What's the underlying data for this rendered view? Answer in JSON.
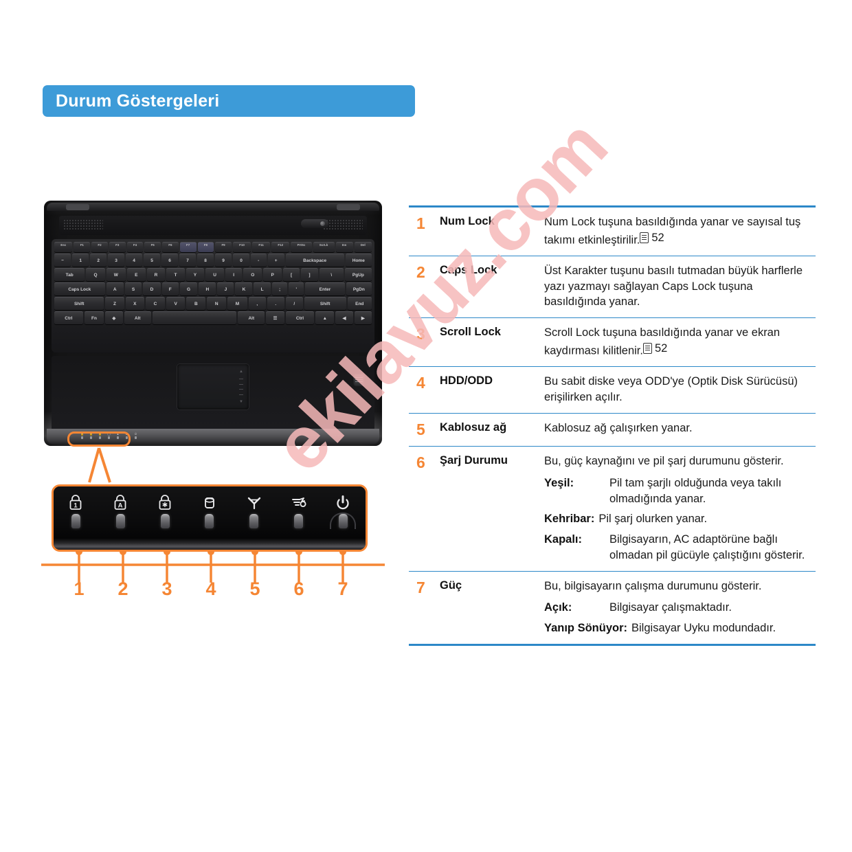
{
  "header": {
    "title": "Durum Göstergeleri",
    "bg_color": "#3d9bd8"
  },
  "watermark": {
    "text": "ekilavuz.com",
    "color": "#f6b9b9"
  },
  "colors": {
    "accent_orange": "#f58634",
    "table_blue": "#2c88c8",
    "header_blue": "#3d9bd8"
  },
  "figure": {
    "callout_numbers": [
      "1",
      "2",
      "3",
      "4",
      "5",
      "6",
      "7"
    ],
    "indicators": [
      {
        "number": "1",
        "icon": "num-lock-icon",
        "glyph": "1"
      },
      {
        "number": "2",
        "icon": "caps-lock-icon",
        "glyph": "A"
      },
      {
        "number": "3",
        "icon": "scroll-lock-icon",
        "glyph": "*"
      },
      {
        "number": "4",
        "icon": "hdd-odd-icon",
        "glyph": ""
      },
      {
        "number": "5",
        "icon": "wireless-network-icon",
        "glyph": ""
      },
      {
        "number": "6",
        "icon": "charge-status-icon",
        "glyph": ""
      },
      {
        "number": "7",
        "icon": "power-icon",
        "glyph": ""
      }
    ]
  },
  "table": {
    "rows": [
      {
        "number": "1",
        "label": "Num Lock",
        "desc_before": "Num Lock tuşuna basıldığında yanar ve sayısal tuş takımı etkinleştirilir.",
        "page_ref": "52",
        "subs": []
      },
      {
        "number": "2",
        "label": "Caps Lock",
        "desc_before": "Üst Karakter tuşunu basılı tutmadan büyük harflerle yazı yazmayı sağlayan Caps Lock tuşuna basıldığında yanar.",
        "page_ref": "",
        "subs": []
      },
      {
        "number": "3",
        "label": "Scroll Lock",
        "desc_before": "Scroll Lock tuşuna basıldığında yanar ve ekran kaydırması kilitlenir.",
        "page_ref": "52",
        "subs": []
      },
      {
        "number": "4",
        "label": "HDD/ODD",
        "desc_before": "Bu sabit diske veya ODD'ye (Optik Disk Sürücüsü) erişilirken açılır.",
        "page_ref": "",
        "subs": []
      },
      {
        "number": "5",
        "label": "Kablosuz ağ",
        "desc_before": "Kablosuz ağ çalışırken yanar.",
        "page_ref": "",
        "subs": []
      },
      {
        "number": "6",
        "label": "Şarj Durumu",
        "desc_before": "Bu, güç kaynağını ve pil şarj durumunu gösterir.",
        "page_ref": "",
        "subs": [
          {
            "term": "Yeşil:",
            "def": "Pil tam şarjlı olduğunda veya takılı olmadığında yanar.",
            "fixed": true
          },
          {
            "term": "Kehribar:",
            "def": "Pil şarj olurken yanar.",
            "fixed": false
          },
          {
            "term": "Kapalı:",
            "def": "Bilgisayarın, AC adaptörüne bağlı olmadan pil gücüyle çalıştığını gösterir.",
            "fixed": true
          }
        ]
      },
      {
        "number": "7",
        "label": "Güç",
        "desc_before": "Bu, bilgisayarın çalışma durumunu gösterir.",
        "page_ref": "",
        "subs": [
          {
            "term": "Açık:",
            "def": "Bilgisayar çalışmaktadır.",
            "fixed": true
          },
          {
            "term": "Yanıp Sönüyor:",
            "def": "Bilgisayar Uyku modundadır.",
            "fixed": false
          }
        ]
      }
    ]
  },
  "keyboard": {
    "fn_row": [
      "Esc",
      "F1",
      "F2",
      "F3",
      "F4",
      "F5",
      "F6",
      "F7",
      "F8",
      "F9",
      "F10",
      "F11",
      "F12",
      "Prt Sc",
      "Scroll",
      "Insert",
      "Delete"
    ],
    "num_row": [
      "~",
      "1",
      "2",
      "3",
      "4",
      "5",
      "6",
      "7",
      "8",
      "9",
      "0",
      "-",
      "+",
      "Backspace",
      "Home"
    ],
    "q_row": [
      "Tab",
      "Q",
      "W",
      "E",
      "R",
      "T",
      "Y",
      "U",
      "I",
      "O",
      "P",
      "[",
      "]",
      "\\",
      "PgUp"
    ],
    "a_row": [
      "Caps Lock",
      "A",
      "S",
      "D",
      "F",
      "G",
      "H",
      "J",
      "K",
      "L",
      ";",
      "'",
      "Enter",
      "PgDn"
    ],
    "z_row": [
      "Shift",
      "Z",
      "X",
      "C",
      "V",
      "B",
      "N",
      "M",
      ",",
      ".",
      "/",
      "Shift",
      "End"
    ],
    "ctrl_row": [
      "Ctrl",
      "Fn",
      "",
      "Alt",
      "",
      "Alt",
      "",
      "Ctrl"
    ]
  }
}
